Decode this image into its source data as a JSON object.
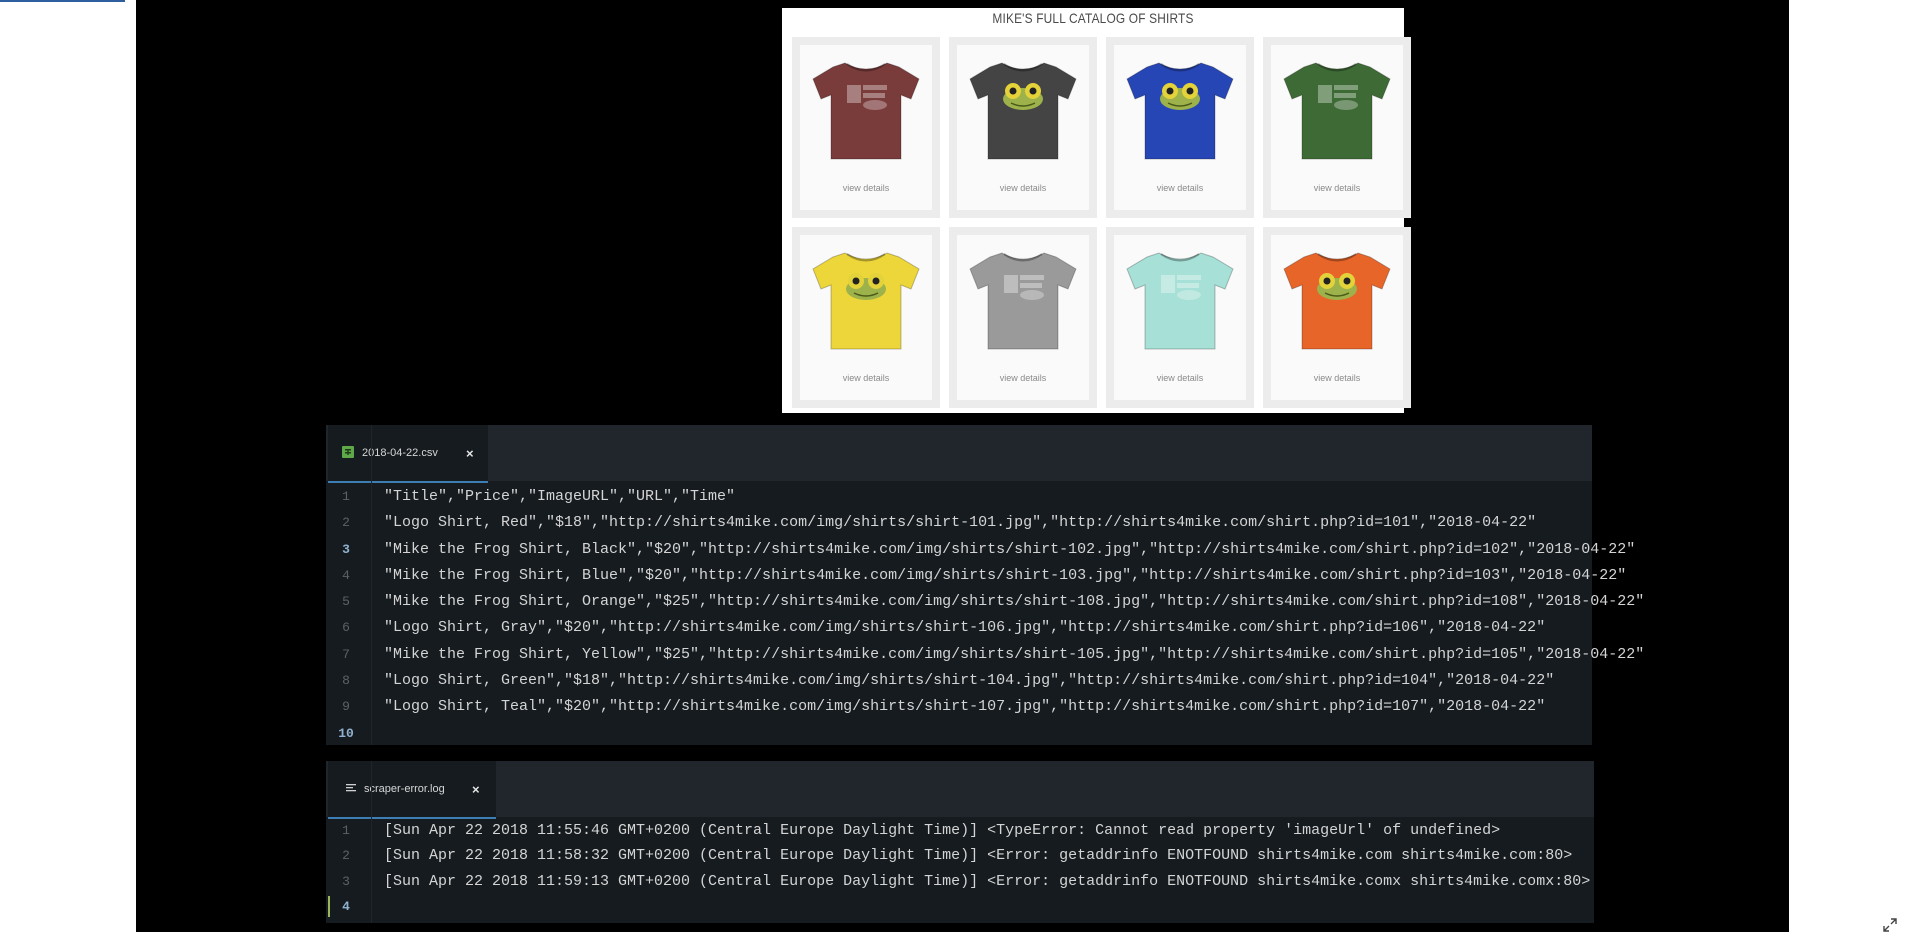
{
  "catalog": {
    "title": "MIKE'S FULL CATALOG OF SHIRTS",
    "products": [
      {
        "color": "#7a3b3b",
        "art": "logo",
        "link": "view details"
      },
      {
        "color": "#444444",
        "art": "frog",
        "link": "view details"
      },
      {
        "color": "#2746b5",
        "art": "frog",
        "link": "view details"
      },
      {
        "color": "#3e6b35",
        "art": "logo",
        "link": "view details"
      },
      {
        "color": "#ecd63a",
        "art": "frog",
        "link": "view details"
      },
      {
        "color": "#9a9a9a",
        "art": "logo",
        "link": "view details"
      },
      {
        "color": "#a6e0d6",
        "art": "logo",
        "link": "view details"
      },
      {
        "color": "#e8652a",
        "art": "frog",
        "link": "view details"
      }
    ]
  },
  "csv_editor": {
    "tab_label": "2018-04-22.csv",
    "close_glyph": "×",
    "active_line": 3,
    "cursor_line": 10,
    "lines": [
      "\"Title\",\"Price\",\"ImageURL\",\"URL\",\"Time\"",
      "\"Logo Shirt, Red\",\"$18\",\"http://shirts4mike.com/img/shirts/shirt-101.jpg\",\"http://shirts4mike.com/shirt.php?id=101\",\"2018-04-22\"",
      "\"Mike the Frog Shirt, Black\",\"$20\",\"http://shirts4mike.com/img/shirts/shirt-102.jpg\",\"http://shirts4mike.com/shirt.php?id=102\",\"2018-04-22\"",
      "\"Mike the Frog Shirt, Blue\",\"$20\",\"http://shirts4mike.com/img/shirts/shirt-103.jpg\",\"http://shirts4mike.com/shirt.php?id=103\",\"2018-04-22\"",
      "\"Mike the Frog Shirt, Orange\",\"$25\",\"http://shirts4mike.com/img/shirts/shirt-108.jpg\",\"http://shirts4mike.com/shirt.php?id=108\",\"2018-04-22\"",
      "\"Logo Shirt, Gray\",\"$20\",\"http://shirts4mike.com/img/shirts/shirt-106.jpg\",\"http://shirts4mike.com/shirt.php?id=106\",\"2018-04-22\"",
      "\"Mike the Frog Shirt, Yellow\",\"$25\",\"http://shirts4mike.com/img/shirts/shirt-105.jpg\",\"http://shirts4mike.com/shirt.php?id=105\",\"2018-04-22\"",
      "\"Logo Shirt, Green\",\"$18\",\"http://shirts4mike.com/img/shirts/shirt-104.jpg\",\"http://shirts4mike.com/shirt.php?id=104\",\"2018-04-22\"",
      "\"Logo Shirt, Teal\",\"$20\",\"http://shirts4mike.com/img/shirts/shirt-107.jpg\",\"http://shirts4mike.com/shirt.php?id=107\",\"2018-04-22\"",
      ""
    ]
  },
  "log_editor": {
    "tab_label": "scraper-error.log",
    "close_glyph": "×",
    "cursor_line": 4,
    "lines": [
      "[Sun Apr 22 2018 11:55:46 GMT+0200 (Central Europe Daylight Time)] <TypeError: Cannot read property 'imageUrl' of undefined>",
      "[Sun Apr 22 2018 11:58:32 GMT+0200 (Central Europe Daylight Time)] <Error: getaddrinfo ENOTFOUND shirts4mike.com shirts4mike.com:80>",
      "[Sun Apr 22 2018 11:59:13 GMT+0200 (Central Europe Daylight Time)] <Error: getaddrinfo ENOTFOUND shirts4mike.comx shirts4mike.comx:80>",
      ""
    ]
  }
}
